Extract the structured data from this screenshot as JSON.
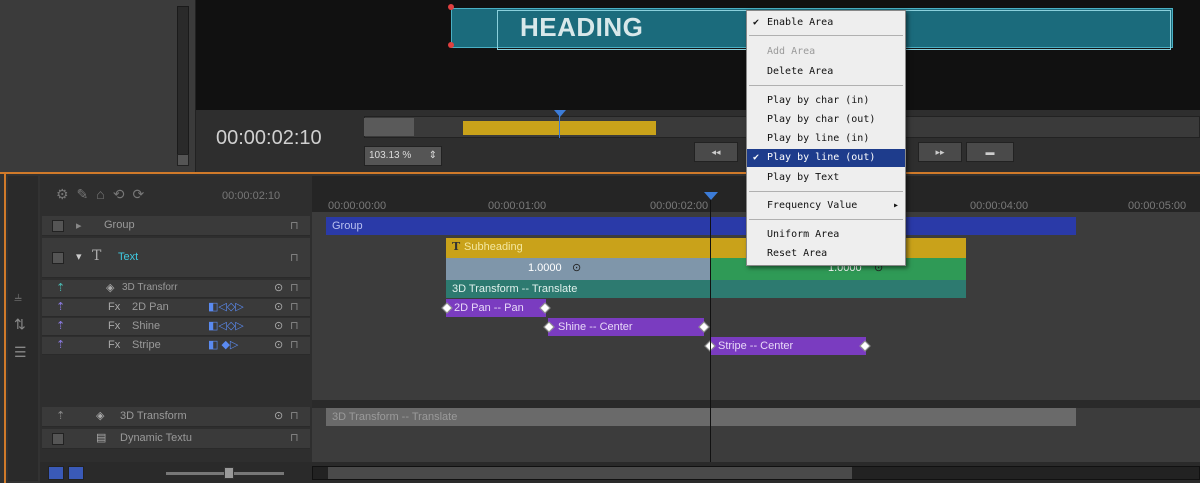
{
  "preview": {
    "heading_text": "HEADING",
    "timecode": "00:00:02:10",
    "zoom": "103.13 %"
  },
  "transport_buttons": [
    "◂◂",
    "▸▸",
    "▬"
  ],
  "context_menu": {
    "items": [
      {
        "label": "Enable Area",
        "checked": true,
        "disabled": false
      },
      {
        "label": "Add Area",
        "checked": false,
        "disabled": true
      },
      {
        "label": "Delete Area",
        "checked": false,
        "disabled": false
      },
      {
        "label": "Play by char (in)",
        "checked": false,
        "disabled": false
      },
      {
        "label": "Play by char (out)",
        "checked": false,
        "disabled": false
      },
      {
        "label": "Play by line (in)",
        "checked": false,
        "disabled": false
      },
      {
        "label": "Play by line (out)",
        "checked": true,
        "disabled": false,
        "highlighted": true
      },
      {
        "label": "Play by Text",
        "checked": false,
        "disabled": false
      },
      {
        "label": "Frequency Value",
        "checked": false,
        "disabled": false,
        "submenu": true
      },
      {
        "label": "Uniform Area",
        "checked": false,
        "disabled": false
      },
      {
        "label": "Reset Area",
        "checked": false,
        "disabled": false
      }
    ]
  },
  "timeline": {
    "header_timecode": "00:00:02:10",
    "ruler_ticks": [
      "00:00:00:00",
      "00:00:01:00",
      "00:00:02:00",
      "00:00:04:00",
      "00:00:05:00"
    ],
    "tracks": [
      {
        "label": "Group"
      },
      {
        "label": "Text"
      },
      {
        "label": "3D Transforr"
      },
      {
        "label": "2D Pan"
      },
      {
        "label": "Shine"
      },
      {
        "label": "Stripe"
      },
      {
        "label": "3D Transform"
      },
      {
        "label": "Dynamic Textu"
      }
    ],
    "clips": {
      "group": "Group",
      "subheading": "Subheading",
      "value_left": "1.0000",
      "value_right": "1.0000",
      "transform": "3D Transform -- Translate",
      "pan": "2D Pan -- Pan",
      "shine": "Shine -- Center",
      "stripe": "Stripe -- Center",
      "transform_bottom": "3D Transform -- Translate"
    },
    "fx_label": "Fx"
  },
  "colors": {
    "group_clip": "#2a3aa8",
    "subheading_clip": "#c9a21a",
    "green_clip": "#2f9a56",
    "teal_clip": "#2d7a70",
    "purple_clip": "#7a3cc0",
    "accent_orange": "#d07a2a",
    "menu_highlight": "#1e3c8c"
  }
}
